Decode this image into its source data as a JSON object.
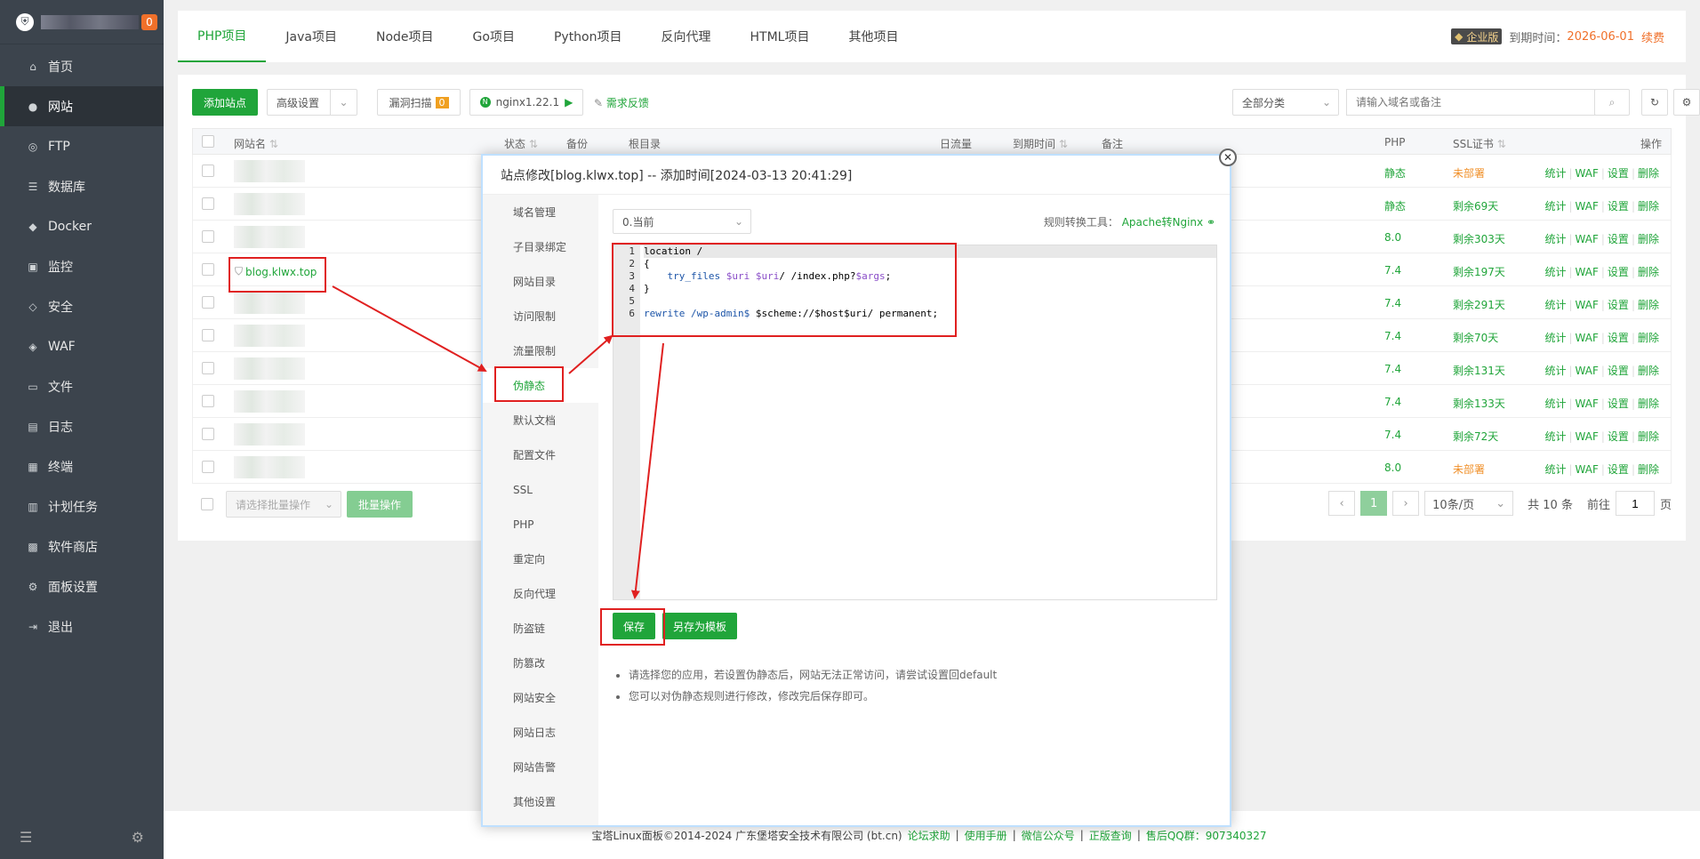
{
  "sidebar": {
    "badge": "0",
    "items": [
      {
        "label": "首页",
        "icon": "home-icon"
      },
      {
        "label": "网站",
        "icon": "globe-icon"
      },
      {
        "label": "FTP",
        "icon": "ftp-icon"
      },
      {
        "label": "数据库",
        "icon": "database-icon"
      },
      {
        "label": "Docker",
        "icon": "docker-icon"
      },
      {
        "label": "监控",
        "icon": "monitor-icon"
      },
      {
        "label": "安全",
        "icon": "shield-icon"
      },
      {
        "label": "WAF",
        "icon": "waf-icon"
      },
      {
        "label": "文件",
        "icon": "folder-icon"
      },
      {
        "label": "日志",
        "icon": "log-icon"
      },
      {
        "label": "终端",
        "icon": "terminal-icon"
      },
      {
        "label": "计划任务",
        "icon": "calendar-icon"
      },
      {
        "label": "软件商店",
        "icon": "store-icon"
      },
      {
        "label": "面板设置",
        "icon": "settings-icon"
      },
      {
        "label": "退出",
        "icon": "logout-icon"
      }
    ]
  },
  "tabs": [
    "PHP项目",
    "Java项目",
    "Node项目",
    "Go项目",
    "Python项目",
    "反向代理",
    "HTML项目",
    "其他项目"
  ],
  "header_right": {
    "edition": "企业版",
    "expire_label": "到期时间：",
    "expire_date": "2026-06-01",
    "renew": "续费"
  },
  "toolbar": {
    "add_site": "添加站点",
    "advanced": "高级设置",
    "vuln_scan": "漏洞扫描",
    "vuln_count": "0",
    "nginx": "nginx1.22.1",
    "feedback": "需求反馈",
    "category": "全部分类",
    "search_placeholder": "请输入域名或备注"
  },
  "table": {
    "headers": {
      "name": "网站名",
      "status": "状态",
      "backup": "备份",
      "root": "根目录",
      "traffic": "日流量",
      "expire": "到期时间",
      "note": "备注",
      "php": "PHP",
      "ssl": "SSL证书",
      "ops": "操作"
    },
    "highlighted_site": "blog.klwx.top",
    "rows": [
      {
        "php": "静态",
        "ssl": "未部署",
        "ssl_status": "warn"
      },
      {
        "php": "静态",
        "ssl": "剩余69天",
        "ssl_status": "ok"
      },
      {
        "php": "8.0",
        "ssl": "剩余303天",
        "ssl_status": "ok"
      },
      {
        "php": "7.4",
        "ssl": "剩余197天",
        "ssl_status": "ok"
      },
      {
        "php": "7.4",
        "ssl": "剩余291天",
        "ssl_status": "ok"
      },
      {
        "php": "7.4",
        "ssl": "剩余70天",
        "ssl_status": "ok"
      },
      {
        "php": "7.4",
        "ssl": "剩余131天",
        "ssl_status": "ok"
      },
      {
        "php": "7.4",
        "ssl": "剩余133天",
        "ssl_status": "ok"
      },
      {
        "php": "7.4",
        "ssl": "剩余72天",
        "ssl_status": "ok"
      },
      {
        "php": "8.0",
        "ssl": "未部署",
        "ssl_status": "warn"
      }
    ],
    "ops": [
      "统计",
      "WAF",
      "设置",
      "删除"
    ]
  },
  "bulk": {
    "select_placeholder": "请选择批量操作",
    "button": "批量操作"
  },
  "pager": {
    "current": "1",
    "per_page": "10条/页",
    "total": "共 10 条",
    "goto_label": "前往",
    "goto_value": "1",
    "page_unit": "页"
  },
  "footer": {
    "copyright": "宝塔Linux面板©2014-2024 广东堡塔安全技术有限公司 (bt.cn)",
    "links": [
      "论坛求助",
      "使用手册",
      "微信公众号",
      "正版查询",
      "售后QQ群：907340327"
    ]
  },
  "modal": {
    "title": "站点修改[blog.klwx.top] -- 添加时间[2024-03-13 20:41:29]",
    "menu": [
      "域名管理",
      "子目录绑定",
      "网站目录",
      "访问限制",
      "流量限制",
      "伪静态",
      "默认文档",
      "配置文件",
      "SSL",
      "PHP",
      "重定向",
      "反向代理",
      "防盗链",
      "防篡改",
      "网站安全",
      "网站日志",
      "网站告警",
      "其他设置"
    ],
    "active_menu": "伪静态",
    "template_select": "0.当前",
    "converter_label": "规则转换工具：",
    "converter_link": "Apache转Nginx",
    "line_numbers": [
      "1",
      "2",
      "3",
      "4",
      "5",
      "6"
    ],
    "save": "保存",
    "save_template": "另存为模板",
    "notes": [
      "请选择您的应用，若设置伪静态后，网站无法正常访问，请尝试设置回default",
      "您可以对伪静态规则进行修改，修改完后保存即可。"
    ]
  },
  "colors": {
    "accent": "#20a53a",
    "sidebar_bg": "#3c444d",
    "warn": "#f0902a",
    "annotation": "#e02020"
  }
}
